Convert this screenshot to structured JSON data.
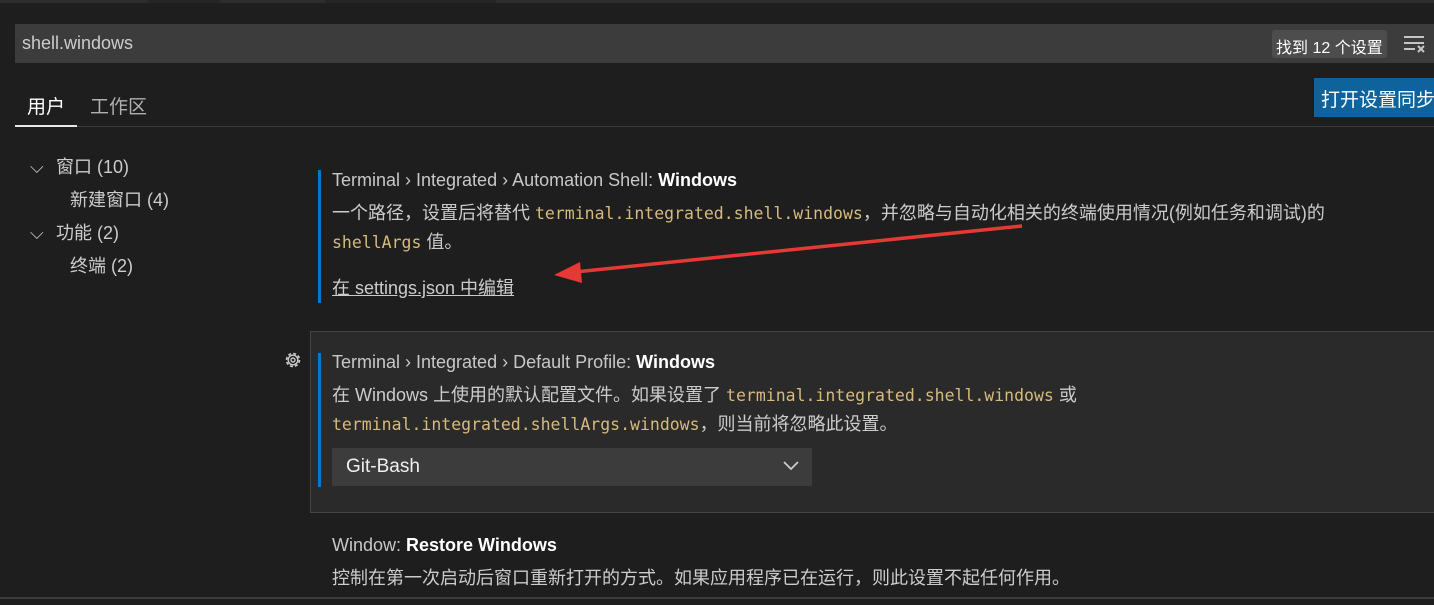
{
  "search": {
    "value": "shell.windows",
    "result_count": "找到 12 个设置",
    "clear_icon": "clear-filter-icon"
  },
  "tabs": [
    {
      "label": "用户",
      "active": true
    },
    {
      "label": "工作区",
      "active": false
    }
  ],
  "sync_button": "打开设置同步",
  "toc": [
    {
      "label": "窗口 (10)",
      "expanded": true
    },
    {
      "label": "新建窗口 (4)"
    },
    {
      "label": "功能 (2)",
      "expanded": true
    },
    {
      "label": "终端 (2)"
    }
  ],
  "settings": [
    {
      "category": "Terminal › Integrated › Automation Shell: ",
      "name": "Windows",
      "desc_pre": "一个路径，设置后将替代 ",
      "desc_code1": "terminal.integrated.shell.windows",
      "desc_mid": "，并忽略与自动化相关的终端使用情况(例如任务和调试)的",
      "desc_code2": "shellArgs",
      "desc_post": " 值。",
      "link": "在 settings.json 中编辑"
    },
    {
      "category": "Terminal › Integrated › Default Profile: ",
      "name": "Windows",
      "desc_pre": "在 Windows 上使用的默认配置文件。如果设置了 ",
      "desc_code1": "terminal.integrated.shell.windows",
      "desc_mid": " 或",
      "desc_code2": "terminal.integrated.shellArgs.windows",
      "desc_post": "，则当前将忽略此设置。",
      "value": "Git-Bash"
    },
    {
      "category": "Window: ",
      "name": "Restore Windows",
      "desc_pre": "控制在第一次启动后窗口重新打开的方式。如果应用程序已在运行，则此设置不起任何作用。"
    }
  ],
  "annotation_color": "#e53935"
}
